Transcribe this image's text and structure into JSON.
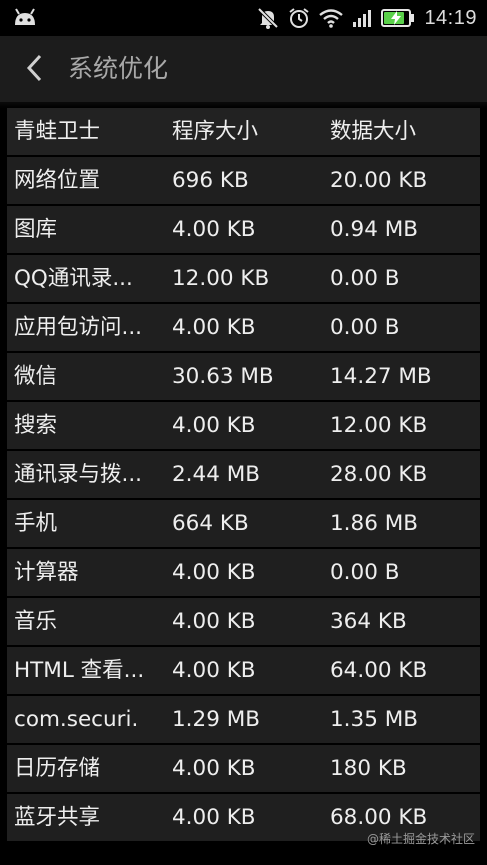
{
  "status_bar": {
    "time": "14:19",
    "battery_level": 0.85,
    "icons": [
      "android-icon",
      "notifications-muted-icon",
      "alarm-clock-icon",
      "wifi-icon",
      "cell-signal-icon",
      "battery-charging-icon"
    ]
  },
  "app_bar": {
    "title": "系统优化",
    "back_icon": "chevron-left-icon"
  },
  "table": {
    "headers": [
      "青蛙卫士",
      "程序大小",
      "数据大小"
    ],
    "rows": [
      {
        "name": "网络位置",
        "app_size": "696 KB",
        "data_size": "20.00 KB"
      },
      {
        "name": "图库",
        "app_size": "4.00 KB",
        "data_size": "0.94 MB"
      },
      {
        "name": "QQ通讯录...",
        "app_size": "12.00 KB",
        "data_size": "0.00 B"
      },
      {
        "name": "应用包访问...",
        "app_size": "4.00 KB",
        "data_size": "0.00 B"
      },
      {
        "name": "微信",
        "app_size": "30.63 MB",
        "data_size": "14.27 MB"
      },
      {
        "name": "搜索",
        "app_size": "4.00 KB",
        "data_size": "12.00 KB"
      },
      {
        "name": "通讯录与拨...",
        "app_size": "2.44 MB",
        "data_size": "28.00 KB"
      },
      {
        "name": "手机",
        "app_size": "664 KB",
        "data_size": "1.86 MB"
      },
      {
        "name": "计算器",
        "app_size": "4.00 KB",
        "data_size": "0.00 B"
      },
      {
        "name": "音乐",
        "app_size": "4.00 KB",
        "data_size": "364 KB"
      },
      {
        "name": "HTML 查看...",
        "app_size": "4.00 KB",
        "data_size": "64.00 KB"
      },
      {
        "name": "com.securi.",
        "app_size": "1.29 MB",
        "data_size": "1.35 MB"
      },
      {
        "name": "日历存储",
        "app_size": "4.00 KB",
        "data_size": "180 KB"
      },
      {
        "name": "蓝牙共享",
        "app_size": "4.00 KB",
        "data_size": "68.00 KB"
      }
    ]
  },
  "watermark": "@稀土掘金技术社区",
  "colors": {
    "background": "#000000",
    "app_bar": "#1c1c1c",
    "row": "#1f1f1f",
    "text": "#eeeeee",
    "title": "#a8a8a8",
    "battery": "#5ad04a"
  }
}
